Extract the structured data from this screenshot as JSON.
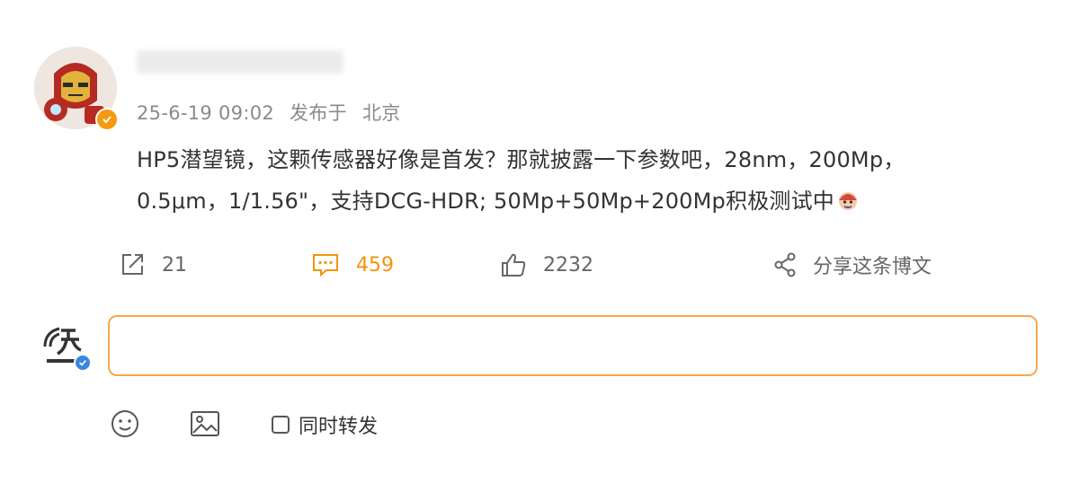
{
  "post": {
    "username": "",
    "date": "25-6-19 09:02",
    "source_prefix": "发布于",
    "location": "北京",
    "text_line1": "HP5潜望镜，这颗传感器好像是首发？那就披露一下参数吧，28nm，200Mp，",
    "text_line2": "0.5μm，1/1.56\"，支持DCG-HDR; 50Mp+50Mp+200Mp积极测试中"
  },
  "actions": {
    "repost_count": "21",
    "comment_count": "459",
    "like_count": "2232",
    "share_label": "分享这条博文"
  },
  "composer": {
    "placeholder": "",
    "sync_repost_label": "同时转发"
  },
  "icons": {
    "repost": "repost-icon",
    "comment": "comment-icon",
    "like": "thumbs-up-icon",
    "share": "share-icon",
    "emoji": "smiley-icon",
    "image": "image-icon"
  },
  "colors": {
    "accent": "#f0950a",
    "verify": "#f59a0e",
    "verify_blue": "#3a86e0",
    "meta_text": "#8a8a8a"
  }
}
